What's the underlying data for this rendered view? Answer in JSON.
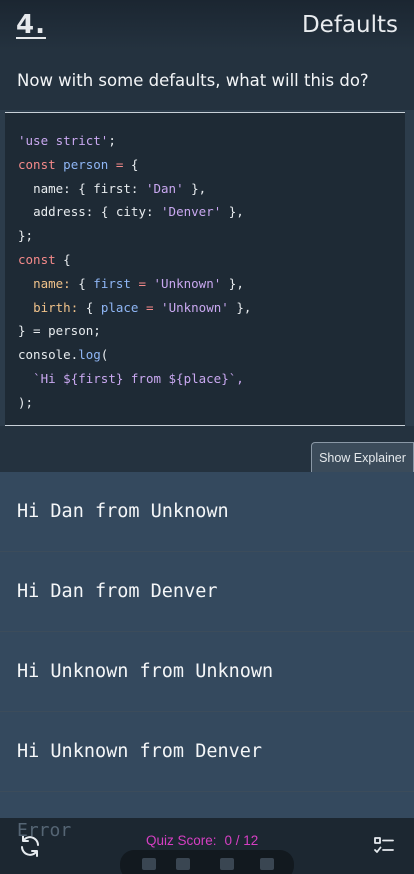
{
  "header": {
    "number": "4.",
    "title": "Defaults"
  },
  "question": {
    "text": "Now with some defaults, what will this do?"
  },
  "code": {
    "l1_str": "'use strict'",
    "l1_end": ";",
    "l2_kw": "const",
    "l2_var": "person",
    "l2_op": "=",
    "l2_end": "{",
    "l3_key": "name:",
    "l3_open": "{ first:",
    "l3_str": "'Dan'",
    "l3_end": "},",
    "l4_key": "address:",
    "l4_open": "{ city:",
    "l4_str": "'Denver'",
    "l4_end": "},",
    "l5": "};",
    "l6_kw": "const",
    "l6_end": "{",
    "l7_prop": "name:",
    "l7_open": "{",
    "l7_var": "first",
    "l7_op": "=",
    "l7_str": "'Unknown'",
    "l7_end": "},",
    "l8_prop": "birth:",
    "l8_open": "{",
    "l8_var": "place",
    "l8_op": "=",
    "l8_str": "'Unknown'",
    "l8_end": "},",
    "l9_close": "} =",
    "l9_var": "person",
    "l9_end": ";",
    "l10_obj": "console.",
    "l10_fn": "log",
    "l10_end": "(",
    "l11": "`Hi ${first} from ${place}`,",
    "l12": ");"
  },
  "explainer": {
    "label": "Show Explainer"
  },
  "answers": [
    "Hi Dan from Unknown",
    "Hi Dan from Denver",
    "Hi Unknown from Unknown",
    "Hi Unknown from Denver",
    "Error"
  ],
  "footer": {
    "score_label": "Quiz Score:",
    "score_value": "0 / 12"
  },
  "colors": {
    "accent": "#d63fc3",
    "keyword": "#f58a8a",
    "string": "#c9a8f0",
    "variable": "#8fb6f5"
  }
}
